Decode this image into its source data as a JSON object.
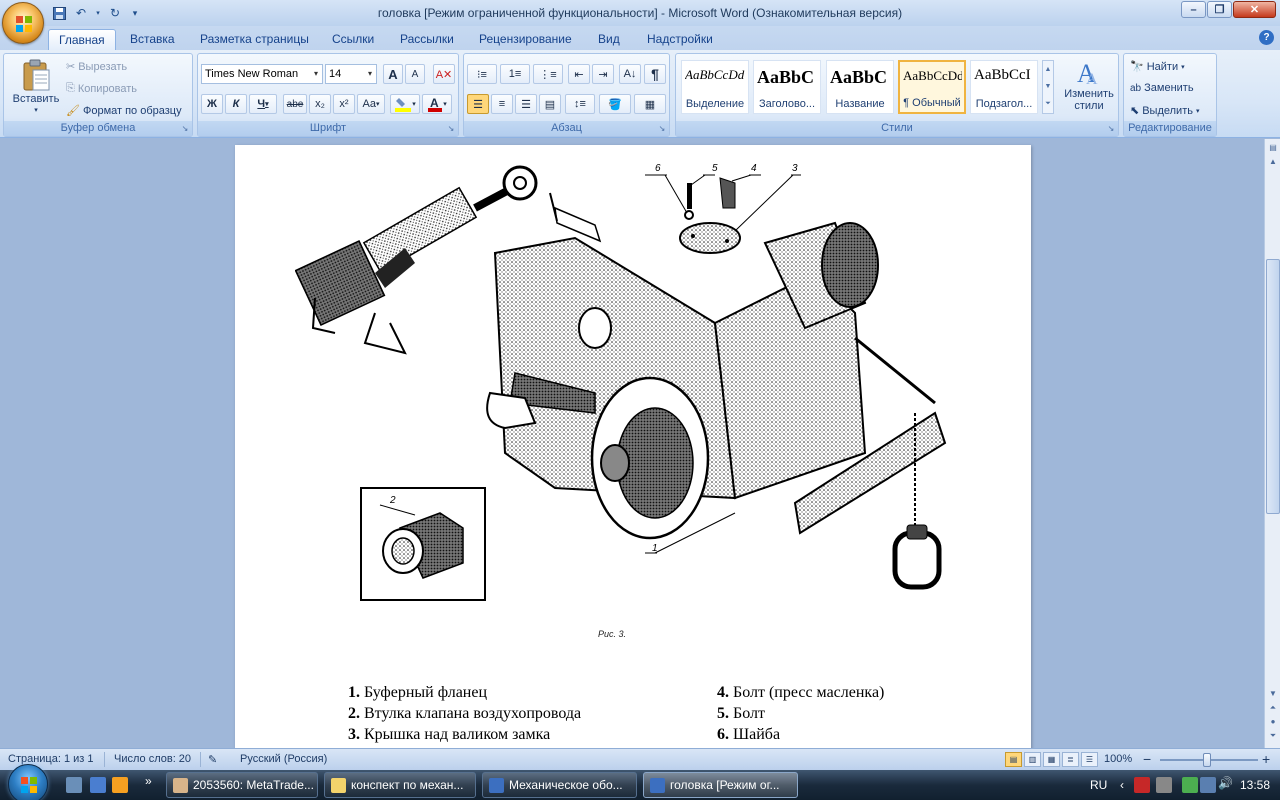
{
  "window": {
    "title": "головка [Режим ограниченной функциональности] - Microsoft Word (Ознакомительная версия)"
  },
  "tabs": [
    {
      "label": "Главная",
      "active": true
    },
    {
      "label": "Вставка"
    },
    {
      "label": "Разметка страницы"
    },
    {
      "label": "Ссылки"
    },
    {
      "label": "Рассылки"
    },
    {
      "label": "Рецензирование"
    },
    {
      "label": "Вид"
    },
    {
      "label": "Надстройки"
    }
  ],
  "ribbon": {
    "clipboard": {
      "label": "Буфер обмена",
      "paste": "Вставить",
      "cut": "Вырезать",
      "copy": "Копировать",
      "format_painter": "Формат по образцу"
    },
    "font": {
      "label": "Шрифт",
      "family": "Times New Roman",
      "size": "14",
      "bold": "Ж",
      "italic": "К",
      "underline": "Ч",
      "strike": "abe",
      "subscript": "x₂",
      "superscript": "x²",
      "change_case": "Aa",
      "grow": "A",
      "shrink": "A",
      "highlight_color": "#ffff00",
      "font_color": "#d00000"
    },
    "paragraph": {
      "label": "Абзац",
      "pilcrow": "¶"
    },
    "styles": {
      "label": "Стили",
      "items": [
        {
          "sample": "AaBbCcDd",
          "name": "Выделение"
        },
        {
          "sample": "AaBbC",
          "name": "Заголово..."
        },
        {
          "sample": "AaBbC",
          "name": "Название"
        },
        {
          "sample": "AaBbCcDd",
          "name": "¶ Обычный",
          "selected": true
        },
        {
          "sample": "AaBbCcI",
          "name": "Подзагол..."
        }
      ],
      "change_styles": "Изменить стили"
    },
    "editing": {
      "label": "Редактирование",
      "find": "Найти",
      "replace": "Заменить",
      "select": "Выделить"
    }
  },
  "document": {
    "figure_labels": [
      "6",
      "5",
      "4",
      "3",
      "2",
      "1"
    ],
    "figure_caption": "Рис. 3.",
    "legend_left": [
      {
        "num": "1.",
        "text": "Буферный фланец"
      },
      {
        "num": "2.",
        "text": "Втулка клапана воздухопровода"
      },
      {
        "num": "3.",
        "text": "Крышка над валиком замка"
      }
    ],
    "legend_right": [
      {
        "num": "4.",
        "text": "Болт (пресс масленка)"
      },
      {
        "num": "5.",
        "text": "Болт"
      },
      {
        "num": "6.",
        "text": "Шайба"
      }
    ]
  },
  "statusbar": {
    "page": "Страница: 1 из 1",
    "words": "Число слов: 20",
    "language": "Русский (Россия)",
    "zoom": "100%",
    "zoom_minus": "−",
    "zoom_plus": "+"
  },
  "taskbar": {
    "tasks": [
      {
        "label": "2053560: MetaTrade...",
        "color": "#d8b48a"
      },
      {
        "label": "конспект по механ...",
        "color": "#f3d36b"
      },
      {
        "label": "Механическое обо...",
        "color": "#3c6fc0"
      },
      {
        "label": "головка [Режим ог...",
        "color": "#3c6fc0",
        "active": true
      }
    ],
    "lang": "RU",
    "clock": "13:58"
  }
}
